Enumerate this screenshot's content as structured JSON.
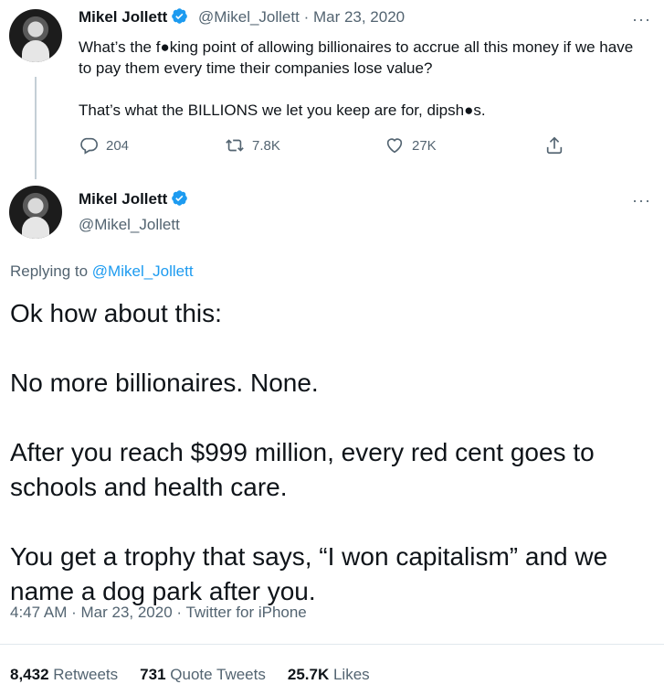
{
  "tweet1": {
    "name": "Mikel Jollett",
    "handle": "@Mikel_Jollett",
    "date": "Mar 23, 2020",
    "text_p1": "What’s the f●king point of allowing billionaires to accrue all this money if we have to pay them every time their companies lose value?",
    "text_p2": "That’s what the BILLIONS we let you keep are for, dipsh●s.",
    "replies": "204",
    "retweets": "7.8K",
    "likes": "27K"
  },
  "tweet2": {
    "name": "Mikel Jollett",
    "handle": "@Mikel_Jollett",
    "replying_label": "Replying to",
    "replying_to": "@Mikel_Jollett",
    "paragraphs": [
      "Ok how about this:",
      "No more billionaires. None.",
      "After you reach $999 million, every red cent goes to schools and health care.",
      "You get a trophy that says, “I won capitalism” and we name a dog park after you."
    ],
    "time": "4:47 AM",
    "date": "Mar 23, 2020",
    "source": "Twitter for iPhone",
    "stats": {
      "retweets_count": "8,432",
      "retweets_label": "Retweets",
      "quotes_count": "731",
      "quotes_label": "Quote Tweets",
      "likes_count": "25.7K",
      "likes_label": "Likes"
    }
  },
  "colors": {
    "accent": "#1d9bf0",
    "muted": "#536471",
    "text": "#0f1419",
    "line": "#c4cfd6"
  },
  "icons": [
    "verified-badge-icon",
    "more-icon",
    "reply-icon",
    "retweet-icon",
    "like-icon",
    "share-icon"
  ]
}
